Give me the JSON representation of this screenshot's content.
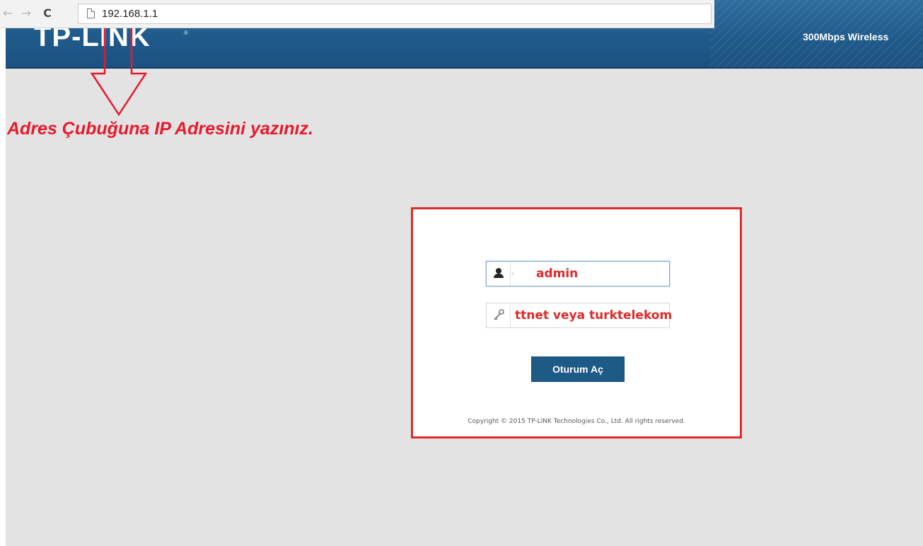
{
  "browser": {
    "back_icon": "arrow-left-icon",
    "forward_icon": "arrow-right-icon",
    "reload_icon": "reload-icon",
    "page_icon": "page-icon",
    "address": "192.168.1.1"
  },
  "router": {
    "brand": "TP-LINK",
    "brand_mark": "®",
    "model": "300Mbps Wireless"
  },
  "annotation": {
    "caption": "Adres Çubuğuna IP Adresini yazınız.",
    "color": "#e8192c"
  },
  "login": {
    "username_value": "admin",
    "password_value": "ttnet veya turktelekom",
    "username_icon": "user-icon",
    "password_icon": "key-icon",
    "submit_label": "Oturum Aç",
    "copyright": "Copyright © 2015 TP-LINK Technologies Co., Ltd. All rights reserved.",
    "highlight_color": "#e02929",
    "button_color": "#1d5a86"
  }
}
